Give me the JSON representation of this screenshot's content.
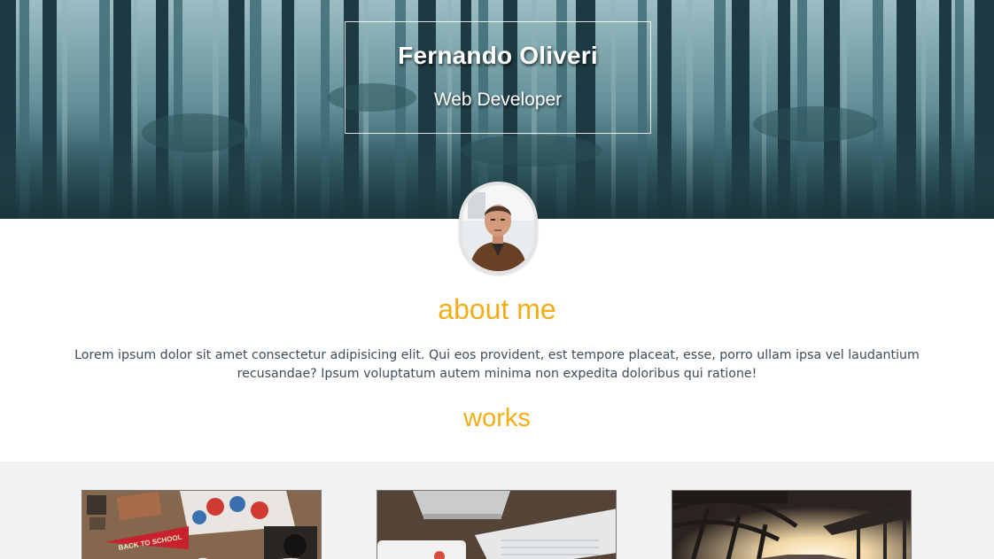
{
  "hero": {
    "name": "Fernando Oliveri",
    "role": "Web Developer"
  },
  "about": {
    "heading": "about me",
    "text": "Lorem ipsum dolor sit amet consectetur adipisicing elit. Qui eos provident, est tempore placeat, esse, porro ullam ipsa vel laudantium recusandae? Ipsum voluptatum autem minima non expedita doloribus qui ratione!"
  },
  "works": {
    "heading": "works",
    "items": [
      {
        "pennant_text": "BACK TO SCHOOL"
      },
      {
        "pennant_text": ""
      },
      {
        "pennant_text": ""
      }
    ]
  },
  "colors": {
    "accent": "#f3ad16",
    "body_text": "#3e4c57",
    "works_background": "#f2f2f2"
  }
}
